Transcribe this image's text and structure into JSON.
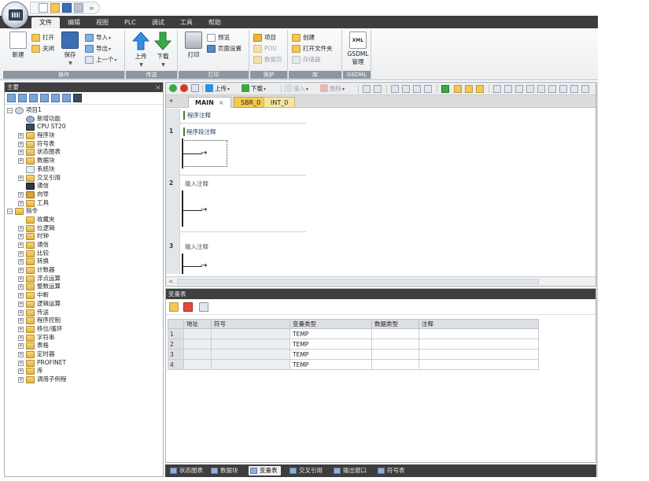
{
  "menu": {
    "tabs": [
      "文件",
      "编辑",
      "视图",
      "PLC",
      "调试",
      "工具",
      "帮助"
    ],
    "active_index": 0,
    "qat_more": "="
  },
  "ribbon": {
    "groups": {
      "operation": {
        "label": "操作",
        "new": "新建",
        "open": "打开",
        "close": "关闭",
        "save": "保存",
        "import": "导入",
        "export": "导出",
        "previous": "上一个"
      },
      "transfer": {
        "label": "传送",
        "upload": "上传",
        "download": "下载"
      },
      "print": {
        "label": "打印",
        "print": "打印",
        "preview": "预览",
        "page_setup": "页面设置"
      },
      "protect": {
        "label": "保护",
        "project": "项目",
        "pou": "POU",
        "data_page": "数据页"
      },
      "library": {
        "label": "库",
        "create": "创建",
        "open_folder": "打开文件夹",
        "memory": "存储器"
      },
      "gsdml": {
        "label": "GSDML",
        "xml": "XML",
        "manage_line1": "GSDML",
        "manage_line2": "管理"
      }
    }
  },
  "tree_panel": {
    "title": "主要",
    "pin": "⇲",
    "nodes": [
      {
        "label": "项目1",
        "level": 0,
        "exp": "−",
        "icon": "proj"
      },
      {
        "label": "新增功能",
        "level": 1,
        "exp": "",
        "icon": "gear"
      },
      {
        "label": "CPU ST20",
        "level": 1,
        "exp": "",
        "icon": "cpu"
      },
      {
        "label": "程序块",
        "level": 1,
        "exp": "+",
        "icon": "folder"
      },
      {
        "label": "符号表",
        "level": 1,
        "exp": "+",
        "icon": "folder"
      },
      {
        "label": "状态图表",
        "level": 1,
        "exp": "+",
        "icon": "folder"
      },
      {
        "label": "数据块",
        "level": 1,
        "exp": "+",
        "icon": "folder"
      },
      {
        "label": "系统块",
        "level": 1,
        "exp": "",
        "icon": "sys"
      },
      {
        "label": "交叉引用",
        "level": 1,
        "exp": "+",
        "icon": "folder"
      },
      {
        "label": "通信",
        "level": 1,
        "exp": "",
        "icon": "comm"
      },
      {
        "label": "向导",
        "level": 1,
        "exp": "+",
        "icon": "wiz"
      },
      {
        "label": "工具",
        "level": 1,
        "exp": "+",
        "icon": "folder"
      },
      {
        "label": "指令",
        "level": 0,
        "exp": "−",
        "icon": "folder"
      },
      {
        "label": "收藏夹",
        "level": 1,
        "exp": "",
        "icon": "folder"
      },
      {
        "label": "位逻辑",
        "level": 1,
        "exp": "+",
        "icon": "folder"
      },
      {
        "label": "时钟",
        "level": 1,
        "exp": "+",
        "icon": "folder"
      },
      {
        "label": "通信",
        "level": 1,
        "exp": "+",
        "icon": "folder"
      },
      {
        "label": "比较",
        "level": 1,
        "exp": "+",
        "icon": "folder"
      },
      {
        "label": "转换",
        "level": 1,
        "exp": "+",
        "icon": "folder"
      },
      {
        "label": "计数器",
        "level": 1,
        "exp": "+",
        "icon": "folder"
      },
      {
        "label": "浮点运算",
        "level": 1,
        "exp": "+",
        "icon": "folder"
      },
      {
        "label": "整数运算",
        "level": 1,
        "exp": "+",
        "icon": "folder"
      },
      {
        "label": "中断",
        "level": 1,
        "exp": "+",
        "icon": "folder"
      },
      {
        "label": "逻辑运算",
        "level": 1,
        "exp": "+",
        "icon": "folder"
      },
      {
        "label": "传送",
        "level": 1,
        "exp": "+",
        "icon": "folder"
      },
      {
        "label": "程序控制",
        "level": 1,
        "exp": "+",
        "icon": "folder"
      },
      {
        "label": "移位/循环",
        "level": 1,
        "exp": "+",
        "icon": "folder"
      },
      {
        "label": "字符串",
        "level": 1,
        "exp": "+",
        "icon": "folder"
      },
      {
        "label": "表格",
        "level": 1,
        "exp": "+",
        "icon": "folder"
      },
      {
        "label": "定时器",
        "level": 1,
        "exp": "+",
        "icon": "folder"
      },
      {
        "label": "PROFINET",
        "level": 1,
        "exp": "+",
        "icon": "folder"
      },
      {
        "label": "库",
        "level": 1,
        "exp": "+",
        "icon": "folder"
      },
      {
        "label": "调用子例程",
        "level": 1,
        "exp": "+",
        "icon": "folder"
      }
    ]
  },
  "editor": {
    "toolbar": {
      "upload": "上传",
      "download": "下载",
      "insert": "插入",
      "delete": "删除"
    },
    "tabs": [
      {
        "label": "MAIN",
        "close": "×"
      },
      {
        "label": "SBR_0"
      },
      {
        "label": "INT_0"
      }
    ],
    "tab_scroll": "◂",
    "program_comment": "程序注释",
    "rungs": [
      {
        "number": "1",
        "comment": "程序段注释"
      },
      {
        "number": "2",
        "comment": "输入注释"
      },
      {
        "number": "3",
        "comment": "输入注释"
      }
    ],
    "contact_glyph": "→",
    "hscroll_left": "<"
  },
  "variable_table": {
    "title": "变量表",
    "columns": [
      "",
      "地址",
      "符号",
      "变量类型",
      "数据类型",
      "注释"
    ],
    "rows": [
      {
        "num": "1",
        "address": "",
        "symbol": "",
        "var_type": "TEMP",
        "data_type": "",
        "comment": ""
      },
      {
        "num": "2",
        "address": "",
        "symbol": "",
        "var_type": "TEMP",
        "data_type": "",
        "comment": ""
      },
      {
        "num": "3",
        "address": "",
        "symbol": "",
        "var_type": "TEMP",
        "data_type": "",
        "comment": ""
      },
      {
        "num": "4",
        "address": "",
        "symbol": "",
        "var_type": "TEMP",
        "data_type": "",
        "comment": ""
      }
    ]
  },
  "bottom_tabs": [
    {
      "label": "状态图表",
      "active": false
    },
    {
      "label": "数据块",
      "active": false
    },
    {
      "label": "变量表",
      "active": true
    },
    {
      "label": "交叉引用",
      "active": false
    },
    {
      "label": "输出窗口",
      "active": false
    },
    {
      "label": "符号表",
      "active": false
    }
  ],
  "colors": {
    "menubar": "#3d3d3d",
    "upload_arrow": "#2f8fe0",
    "download_arrow": "#3aa845",
    "run_green": "#3aa845",
    "stop_red": "#d9362b",
    "tab_sbr": "#f6c94b"
  }
}
